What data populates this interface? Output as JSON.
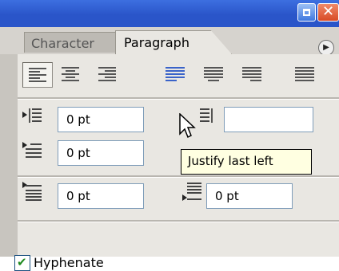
{
  "tabs": [
    {
      "label": "Character",
      "active": false
    },
    {
      "label": "Paragraph",
      "active": true
    }
  ],
  "icons": {
    "minimize": "minimize-icon",
    "close": "close-icon",
    "panel_menu": "panel-menu-icon",
    "close_glyph": "✕",
    "menu_glyph": "▶",
    "check_glyph": "✔"
  },
  "alignment_buttons": [
    {
      "name": "align-left-button",
      "pressed": true
    },
    {
      "name": "align-center-button",
      "pressed": false
    },
    {
      "name": "align-right-button",
      "pressed": false
    },
    {
      "name": "justify-last-left-button",
      "pressed": false,
      "hovered": true
    },
    {
      "name": "justify-last-center-button",
      "pressed": false
    },
    {
      "name": "justify-last-right-button",
      "pressed": false
    },
    {
      "name": "justify-all-button",
      "pressed": false
    }
  ],
  "fields": {
    "left_indent": {
      "value": "0 pt"
    },
    "first_line_indent": {
      "value": "0 pt"
    },
    "space_before": {
      "value": "0 pt"
    },
    "space_after": {
      "value": "0 pt"
    }
  },
  "tooltip": {
    "text": "Justify last left"
  },
  "hyphenate": {
    "label": "Hyphenate",
    "checked": true
  },
  "colors": {
    "titlebar": "#2a55c9",
    "panel": "#d6d3ce",
    "content": "#e9e7e2",
    "tooltip_bg": "#ffffe1",
    "icon_lines": "#555555",
    "justify_hover": "#3a63c9",
    "check": "#1f8a1f"
  }
}
